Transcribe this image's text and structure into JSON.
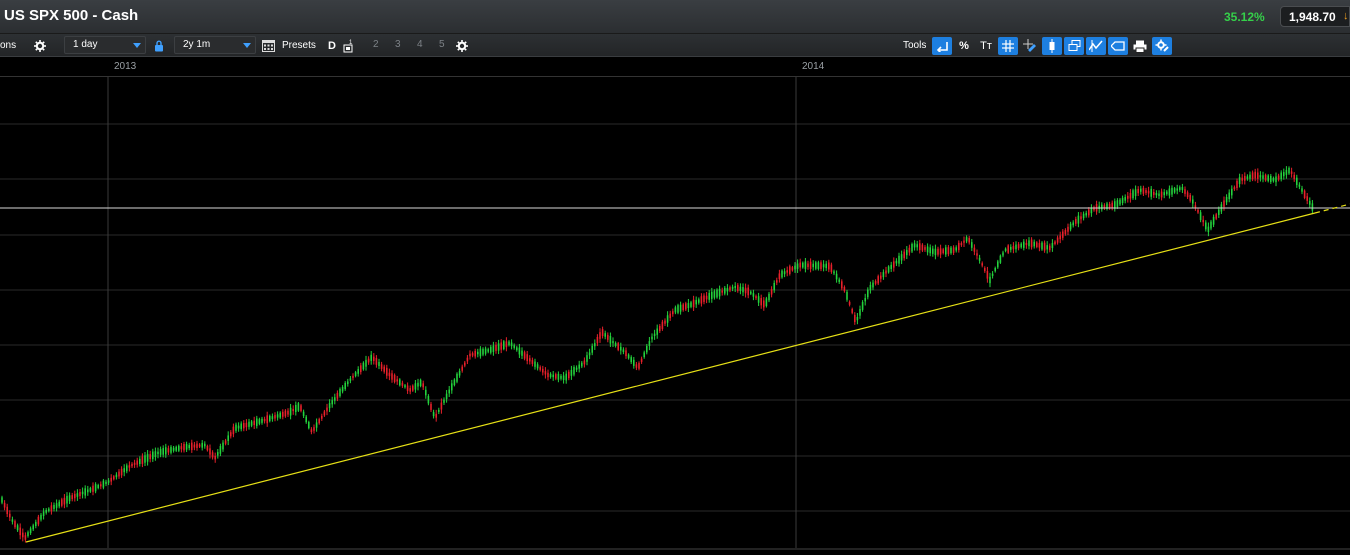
{
  "header": {
    "title": "US SPX 500 - Cash",
    "change": "35.12%",
    "price": "1,948.70",
    "change_color": "#35d04a",
    "price_arrow_icon": "arrow-down-icon"
  },
  "toolbar": {
    "options_label": "ons",
    "interval_value": "1 day",
    "range_value": "2y 1m",
    "presets_label": "Presets",
    "period_label": "D",
    "preset_numbers": [
      "2",
      "3",
      "4",
      "5"
    ],
    "tools_label": "Tools",
    "percent_label": "%",
    "text_tool_label": "Tт"
  },
  "timeline": {
    "year_1": "2013",
    "year_2": "2014"
  },
  "colors": {
    "up_candle": "#23d33c",
    "down_candle": "#e8202a",
    "trendline": "#e6e016",
    "horizontal_line": "#d8d8d8",
    "grid": "#2a2a2a",
    "accent": "#1d7fe0"
  }
}
